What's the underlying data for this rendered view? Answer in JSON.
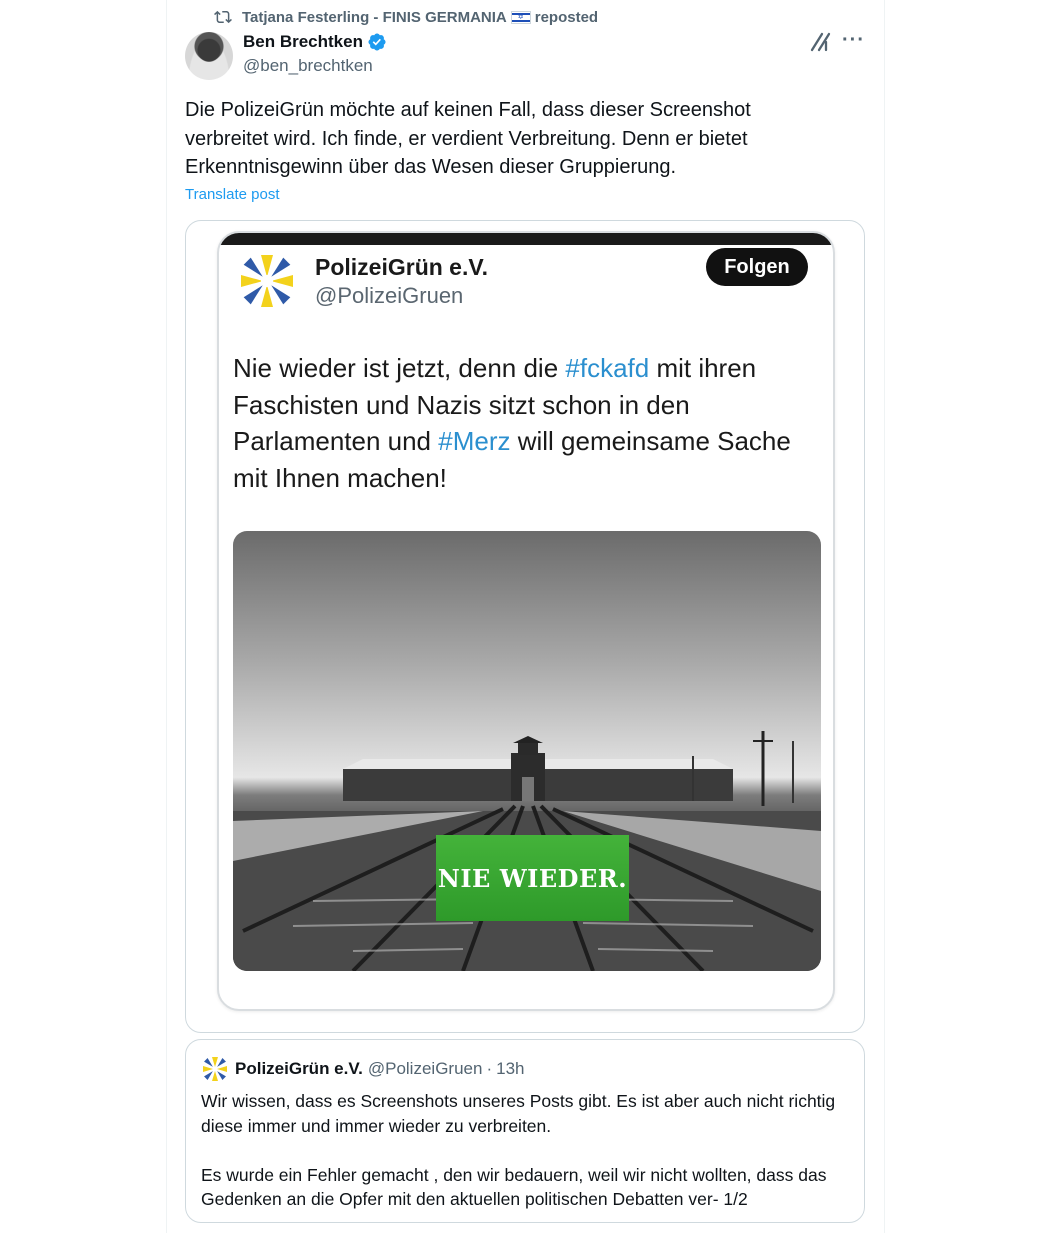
{
  "repost": {
    "reposter": "Tatjana Festerling - FINIS GERMANIA",
    "flag_icon": "israel-flag-icon",
    "suffix": "reposted"
  },
  "author": {
    "name": "Ben Brechtken",
    "handle": "@ben_brechtken",
    "verified": true
  },
  "post": {
    "text": "Die PolizeiGrün möchte auf keinen Fall, dass dieser Screenshot verbreitet wird. Ich finde, er verdient Verbreitung. Denn er bietet Erkenntnisgewinn über das Wesen dieser Gruppierung.",
    "translate_label": "Translate post"
  },
  "screenshot": {
    "account_name": "PolizeiGrün e.V.",
    "account_handle": "@PolizeiGruen",
    "follow_label": "Folgen",
    "text_before_tag1": "Nie wieder ist jetzt, denn die ",
    "hashtag1": "#fckafd",
    "text_between": " mit ihren Faschisten und Nazis sitzt schon in den Parlamenten und ",
    "hashtag2": "#Merz",
    "text_after": " will gemeinsame Sache mit Ihnen machen!",
    "image_badge": "NIE WIEDER."
  },
  "quote": {
    "name": "PolizeiGrün e.V.",
    "handle": "@PolizeiGruen",
    "separator": "·",
    "time": "13h",
    "text": "Wir wissen, dass es Screenshots unseres Posts gibt. Es ist aber auch nicht richtig diese immer und immer wieder zu verbreiten.\n\nEs wurde ein Fehler gemacht , den wir bedauern, weil wir nicht wollten, dass das Gedenken an die Opfer mit den aktuellen politischen Debatten ver- 1/2"
  },
  "colors": {
    "link": "#1d9bf0",
    "verified": "#1d9bf0",
    "hashtag": "#2b8fcf",
    "badge_green": "#3aa833"
  }
}
